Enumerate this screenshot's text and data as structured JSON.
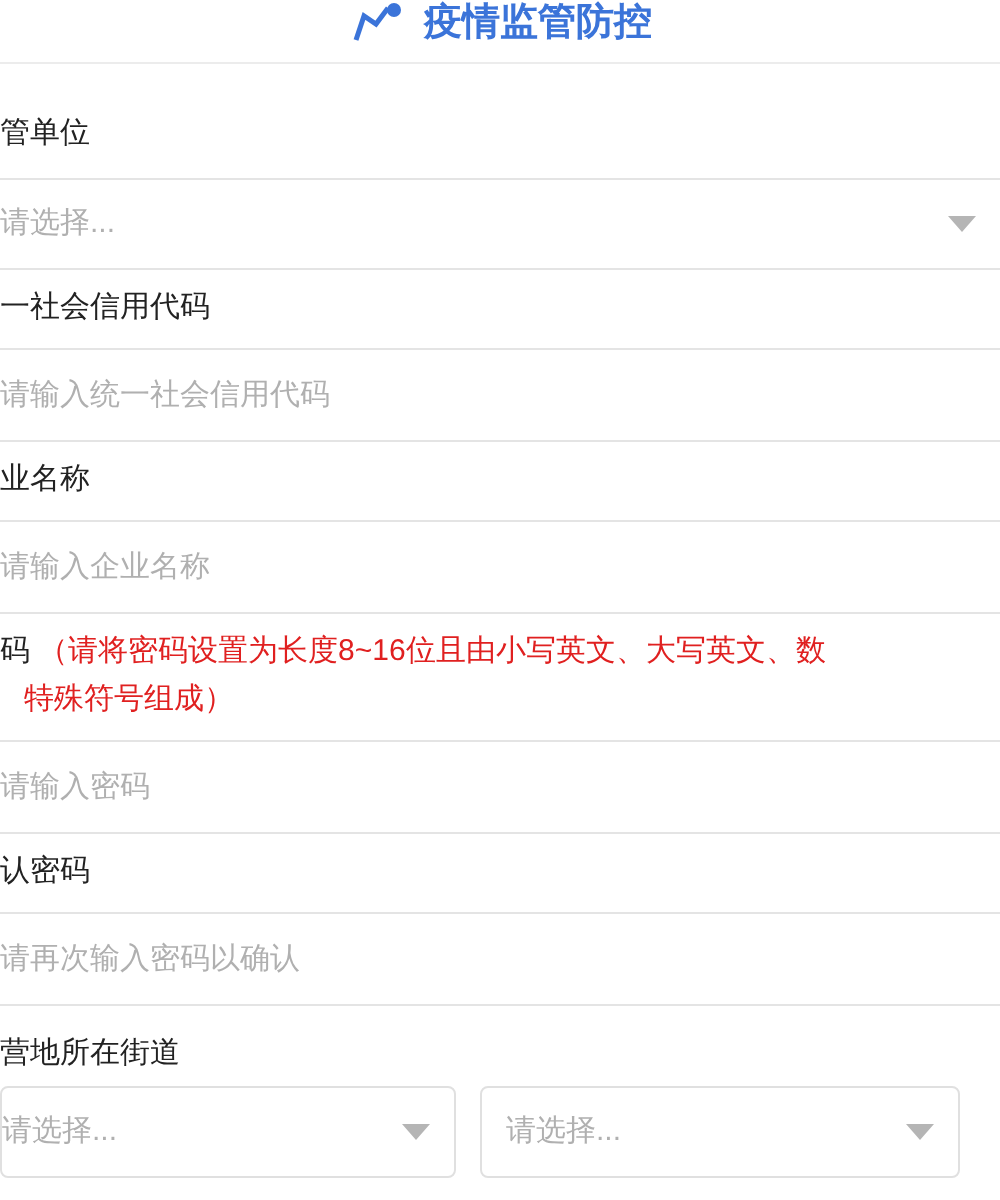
{
  "header": {
    "title": "疫情监管防控"
  },
  "fields": [
    {
      "label": "管单位",
      "controls": [
        {
          "kind": "select",
          "placeholder": "请选择..."
        }
      ]
    },
    {
      "label": "一社会信用代码",
      "controls": [
        {
          "kind": "input",
          "placeholder": "请输入统一社会信用代码"
        }
      ]
    },
    {
      "label": "业名称",
      "controls": [
        {
          "kind": "input",
          "placeholder": "请输入企业名称"
        }
      ]
    },
    {
      "label": "码",
      "hint": "（请将密码设置为长度8~16位且由小写英文、大写英文、数",
      "hint_cont": "特殊符号组成）",
      "controls": [
        {
          "kind": "input",
          "placeholder": "请输入密码"
        }
      ]
    },
    {
      "label": "认密码",
      "controls": [
        {
          "kind": "input",
          "placeholder": "请再次输入密码以确认"
        }
      ]
    },
    {
      "label": "营地所在街道",
      "controls": [
        {
          "kind": "boxed-select",
          "placeholder": "请选择..."
        },
        {
          "kind": "boxed-select",
          "placeholder": "请选择..."
        }
      ]
    }
  ]
}
